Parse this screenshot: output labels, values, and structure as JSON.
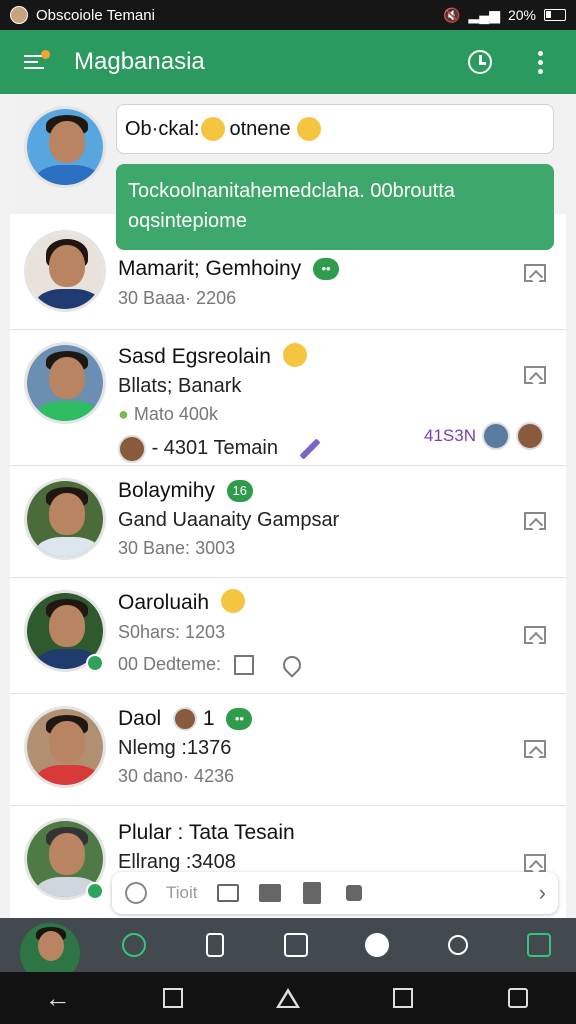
{
  "status_bar": {
    "carrier": "Obscoiole Temani",
    "battery": "20%"
  },
  "app_bar": {
    "title": "Magbanasia"
  },
  "pinned": {
    "question": "Ob·ckal: ",
    "question_tail": "otnene",
    "reply": "Tockoolnanitahemedclaha. 00broutta oqsintepiome"
  },
  "conversations": [
    {
      "name": "Mamarit; Gemhoiny",
      "meta": "30 Baaa· 2206",
      "badge": ""
    },
    {
      "name": "Sasd Egsreolain",
      "line2": "Bllats; Banark",
      "meta": "Mato 400k",
      "extra": "- 4301 Temain",
      "count": "41S3N"
    },
    {
      "name": "Bolaymihy",
      "badge": "16",
      "line2": "Gand Uaanaity Gampsar",
      "meta": "30 Bane: 3003"
    },
    {
      "name": "Oaroluaih",
      "line2": "S0hars: 1203",
      "meta": "00 Dedteme:"
    },
    {
      "name": "Daol",
      "badge": "1",
      "line2": "Nlemg :1376",
      "meta": "30 dano· 4236"
    },
    {
      "name": "Plular : Tata Tesain",
      "line2": "Ellrang :3408"
    }
  ],
  "float_bar": {
    "label": "Tioit"
  },
  "colors": {
    "primary": "#2a9a5e",
    "bubble": "#3ea86c",
    "navbar": "#434a4f"
  }
}
